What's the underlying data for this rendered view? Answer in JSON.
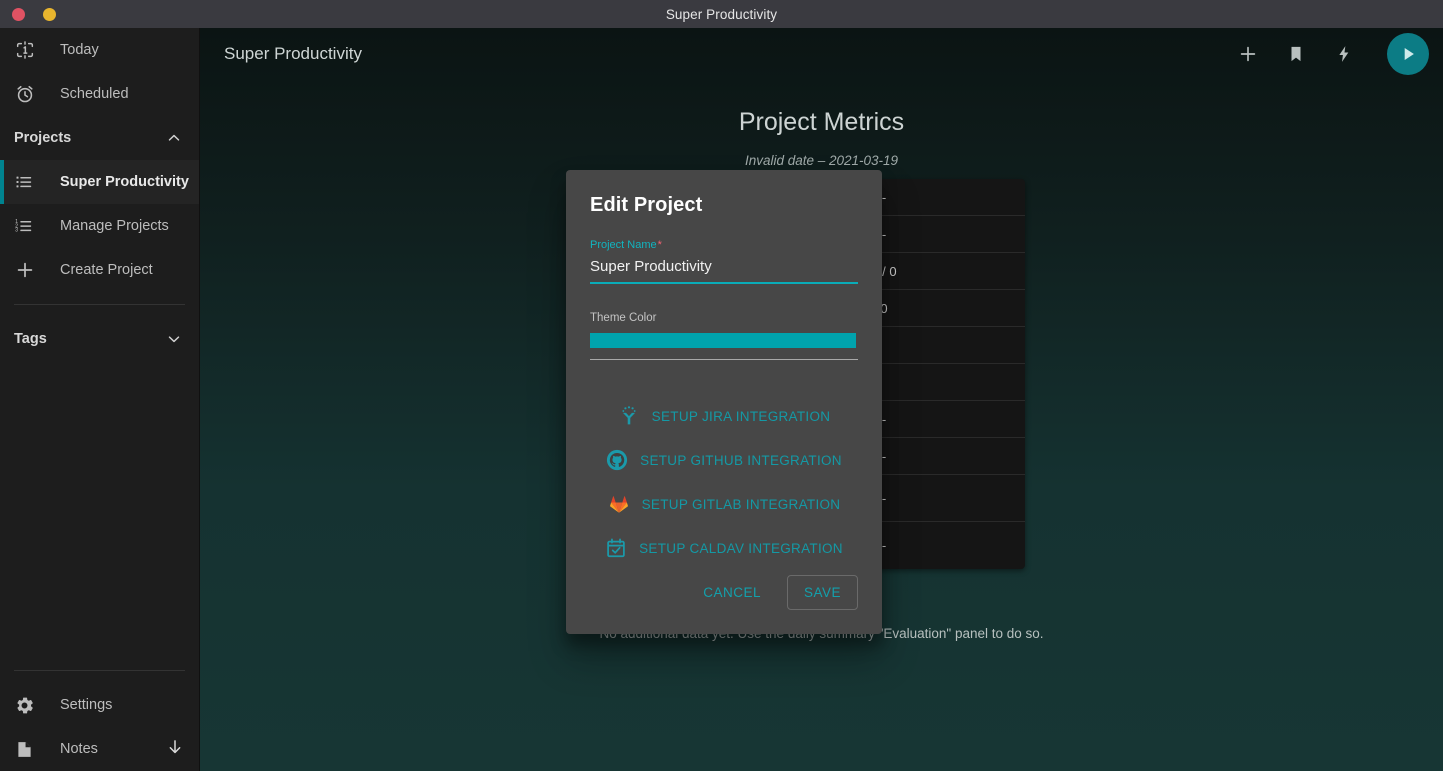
{
  "window": {
    "title": "Super Productivity",
    "buttons": [
      {
        "name": "close",
        "color": "#e05263"
      },
      {
        "name": "minimize",
        "color": "#e8b52e"
      }
    ]
  },
  "sidebar": {
    "top_items": [
      {
        "label": "Today",
        "icon": "today-icon"
      },
      {
        "label": "Scheduled",
        "icon": "alarm-clock-icon"
      }
    ],
    "projects_section": {
      "label": "Projects",
      "expanded": true,
      "chevron": "chevron-up-icon",
      "items": [
        {
          "label": "Super Productivity",
          "icon": "list-icon",
          "active": true
        },
        {
          "label": "Manage Projects",
          "icon": "numbered-list-icon",
          "active": false
        },
        {
          "label": "Create Project",
          "icon": "plus-icon",
          "active": false
        }
      ]
    },
    "tags_section": {
      "label": "Tags",
      "expanded": false,
      "chevron": "chevron-down-icon"
    },
    "bottom_items": [
      {
        "label": "Settings",
        "icon": "gear-icon",
        "trailing": ""
      },
      {
        "label": "Notes",
        "icon": "note-icon",
        "trailing": "arrow-down-icon"
      }
    ],
    "accent_color": "#00838f"
  },
  "topbar": {
    "title": "Super Productivity",
    "actions": [
      {
        "name": "add-button",
        "icon": "plus-icon"
      },
      {
        "name": "bookmark-button",
        "icon": "bookmark-icon"
      },
      {
        "name": "flash-button",
        "icon": "lightning-bolt-icon"
      }
    ],
    "play_button": {
      "name": "play-button",
      "icon": "play-icon",
      "color": "#0c7c85"
    }
  },
  "main": {
    "page_title": "Project Metrics",
    "date_range": "Invalid date – 2021-03-19",
    "footnote": "No additional data yet. Use the daily summary \"Evaluation\" panel to do so.",
    "metrics_rows": [
      {
        "label": "",
        "value": "-"
      },
      {
        "label": "",
        "value": "-"
      },
      {
        "label": "",
        "value": "0 / 0"
      },
      {
        "label": "",
        "value": "0"
      },
      {
        "label": "",
        "value": ""
      },
      {
        "label": "",
        "value": ""
      },
      {
        "label": "",
        "value": "-"
      },
      {
        "label": "",
        "value": "-"
      },
      {
        "label": "",
        "value": "-"
      },
      {
        "label": "",
        "value": "-"
      }
    ]
  },
  "dialog": {
    "title": "Edit Project",
    "project_name": {
      "label": "Project Name",
      "required_marker": "*",
      "value": "Super Productivity",
      "placeholder": ""
    },
    "theme_color": {
      "label": "Theme Color",
      "value": "#00a3ad"
    },
    "integrations": [
      {
        "label": "SETUP JIRA INTEGRATION",
        "icon": "jira-icon"
      },
      {
        "label": "SETUP GITHUB INTEGRATION",
        "icon": "github-icon"
      },
      {
        "label": "SETUP GITLAB INTEGRATION",
        "icon": "gitlab-icon"
      },
      {
        "label": "SETUP CALDAV INTEGRATION",
        "icon": "caldav-calendar-icon"
      }
    ],
    "cancel_label": "CANCEL",
    "save_label": "SAVE"
  }
}
